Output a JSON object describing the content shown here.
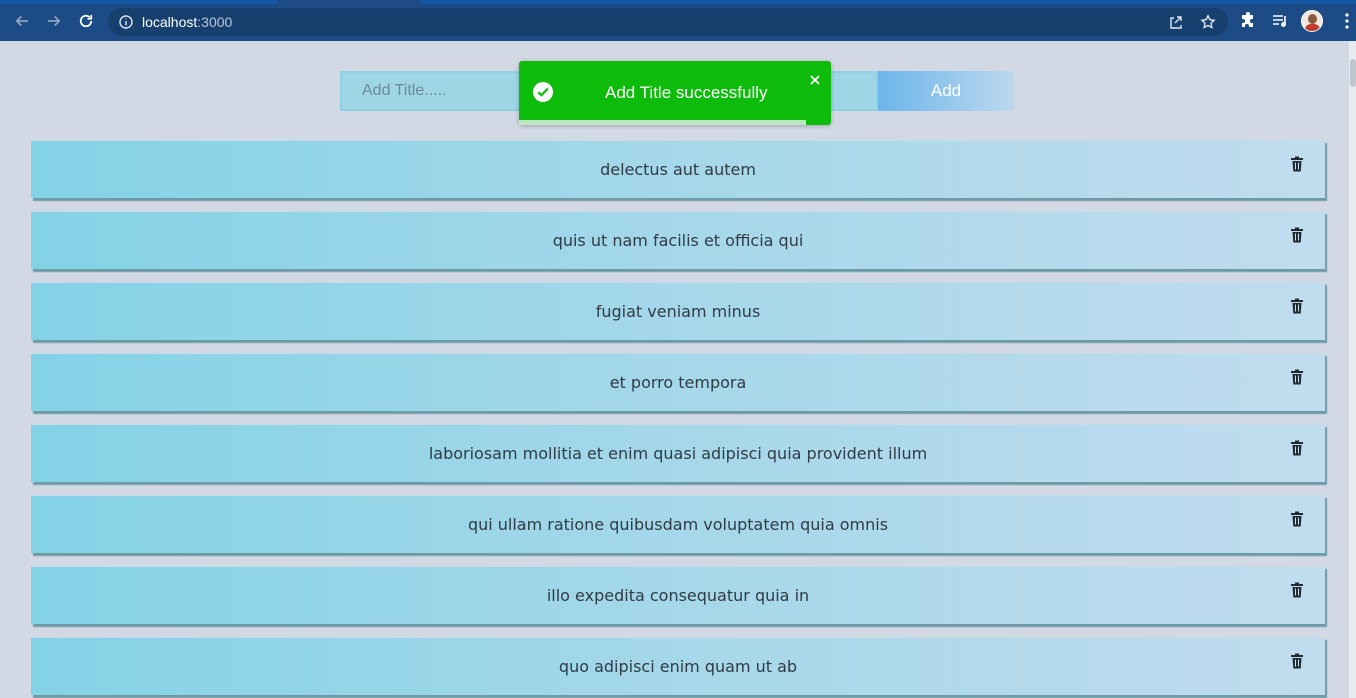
{
  "browser": {
    "url_host": "localhost",
    "url_port": ":3000"
  },
  "form": {
    "input_placeholder": "Add Title.....",
    "add_label": "Add"
  },
  "toast": {
    "message": "Add Title successfully",
    "status": "success",
    "progress": 0.92,
    "color": "#0dbb0a"
  },
  "todos": [
    {
      "title": "delectus aut autem"
    },
    {
      "title": "quis ut nam facilis et officia qui"
    },
    {
      "title": "fugiat veniam minus"
    },
    {
      "title": "et porro tempora"
    },
    {
      "title": "laboriosam mollitia et enim quasi adipisci quia provident illum"
    },
    {
      "title": "qui ullam ratione quibusdam voluptatem quia omnis"
    },
    {
      "title": "illo expedita consequatur quia in"
    },
    {
      "title": "quo adipisci enim quam ut ab"
    }
  ],
  "icons": {
    "back": "back-arrow-icon",
    "forward": "forward-arrow-icon",
    "reload": "reload-icon",
    "info": "info-icon",
    "share": "share-icon",
    "bookmark": "star-icon",
    "extensions": "puzzle-icon",
    "media": "media-queue-icon",
    "menu": "kebab-menu-icon",
    "delete": "trash-icon",
    "toast_status": "check-circle-icon",
    "toast_close": "close-icon"
  }
}
